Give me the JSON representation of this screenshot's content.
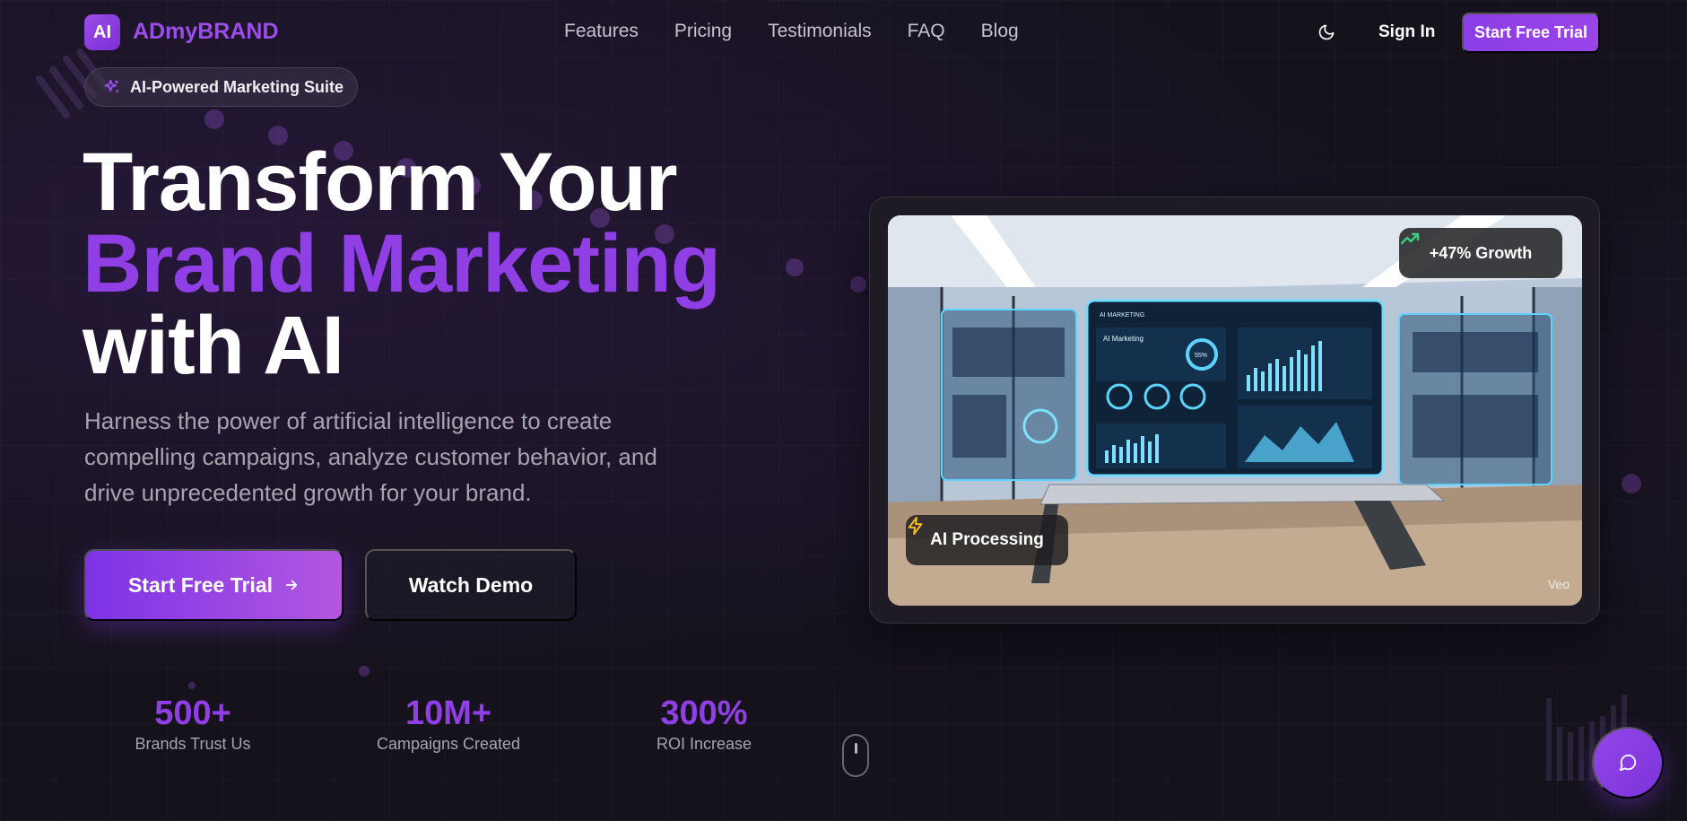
{
  "brand": {
    "logo_mark": "AI",
    "name": "ADmyBRAND"
  },
  "nav": {
    "links": [
      "Features",
      "Pricing",
      "Testimonials",
      "FAQ",
      "Blog"
    ],
    "theme_icon": "moon-icon",
    "sign_in": "Sign In",
    "cta": "Start Free Trial"
  },
  "hero": {
    "badge": "AI-Powered Marketing Suite",
    "badge_icon": "sparkles-icon",
    "headline_line1": "Transform Your",
    "headline_line2": "Brand Marketing",
    "headline_line3": "with AI",
    "subtext": "Harness the power of artificial intelligence to create compelling campaigns, analyze customer behavior, and drive unprecedented growth for your brand.",
    "cta_primary": "Start Free Trial",
    "cta_secondary": "Watch Demo"
  },
  "stats": [
    {
      "value": "500+",
      "label": "Brands Trust Us"
    },
    {
      "value": "10M+",
      "label": "Campaigns Created"
    },
    {
      "value": "300%",
      "label": "ROI Increase"
    }
  ],
  "media_card": {
    "growth_badge": "+47% Growth",
    "growth_icon": "trending-up-icon",
    "processing_badge": "AI Processing",
    "processing_icon": "lightning-icon",
    "watermark": "Veo",
    "screen_title": "AI MARKETING",
    "screen_subtitle": "AI Marketing",
    "screen_gauge": "55%"
  },
  "colors": {
    "accent": "#8f3fe3",
    "background": "#15121c",
    "growth_green": "#34d27b",
    "lightning": "#f5b921"
  }
}
